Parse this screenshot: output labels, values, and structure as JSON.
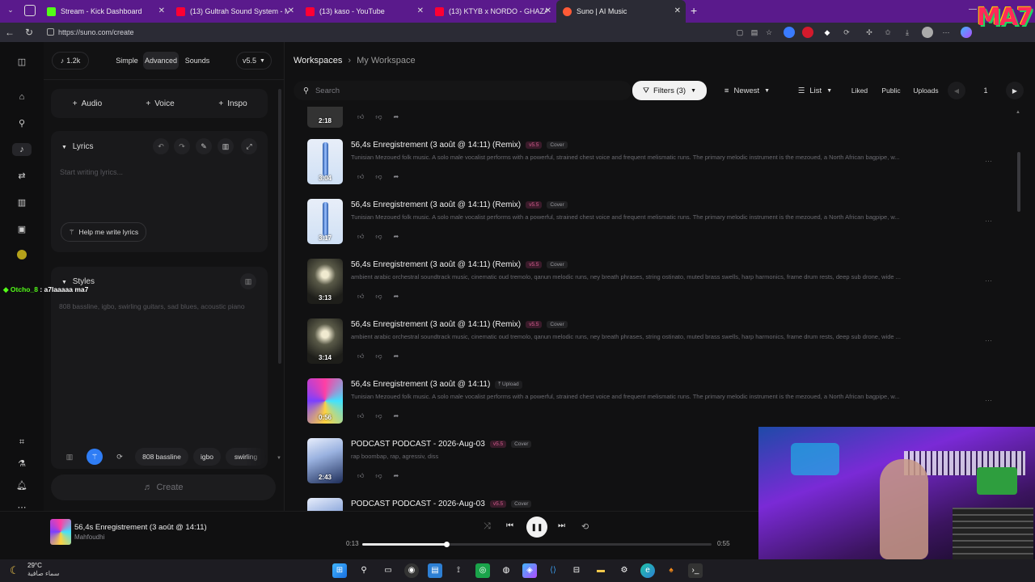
{
  "browser": {
    "tabs": [
      {
        "title": "Stream - Kick Dashboard",
        "color": "#53fc18"
      },
      {
        "title": "(13) Gultrah Sound System - Maze",
        "color": "#ff0033"
      },
      {
        "title": "(13) kaso - YouTube",
        "color": "#ff0033"
      },
      {
        "title": "(13) KTYB x NORDO - GHAZALI (P",
        "color": "#ff0033"
      },
      {
        "title": "Suno | AI Music",
        "color": "#ff5a36"
      }
    ],
    "url": "https://suno.com/create"
  },
  "overlay": {
    "logo_text": "MA7",
    "chat_user": "Otcho_8",
    "chat_message": ": a7laaaaa ma7"
  },
  "create_panel": {
    "credits": "1.2k",
    "modes": [
      "Simple",
      "Advanced",
      "Sounds"
    ],
    "active_mode": "Advanced",
    "model": "v5.5",
    "add_buttons": [
      "Audio",
      "Voice",
      "Inspo"
    ],
    "lyrics": {
      "label": "Lyrics",
      "placeholder": "Start writing lyrics...",
      "help_button": "Help me write lyrics"
    },
    "styles": {
      "label": "Styles",
      "placeholder": "808 bassline, igbo, swirling guitars, sad blues, acoustic piano",
      "tags": [
        "808 bassline",
        "igbo",
        "swirling"
      ]
    },
    "create_label": "Create"
  },
  "workspace": {
    "breadcrumb_root": "Workspaces",
    "breadcrumb_current": "My Workspace",
    "search_placeholder": "Search",
    "filters_label": "Filters (3)",
    "sort_label": "Newest",
    "view_label": "List",
    "chips": [
      "Liked",
      "Public",
      "Uploads"
    ],
    "page": "1",
    "top_partial_duration": "2:18"
  },
  "songs": [
    {
      "title": "56,4s Enregistrement (3 août @ 14:11) (Remix)",
      "version": "v5.5",
      "type": "Cover",
      "duration": "3:04",
      "desc": "Tunisian Mezoued folk music. A solo male vocalist performs with a powerful, strained chest voice and frequent melismatic runs. The primary melodic instrument is the mezoued, a North African bagpipe, w...",
      "thumb": "bagpipe"
    },
    {
      "title": "56,4s Enregistrement (3 août @ 14:11) (Remix)",
      "version": "v5.5",
      "type": "Cover",
      "duration": "3:17",
      "desc": "Tunisian Mezoued folk music. A solo male vocalist performs with a powerful, strained chest voice and frequent melismatic runs. The primary melodic instrument is the mezoued, a North African bagpipe, w...",
      "thumb": "bagpipe"
    },
    {
      "title": "56,4s Enregistrement (3 août @ 14:11) (Remix)",
      "version": "v5.5",
      "type": "Cover",
      "duration": "3:13",
      "desc": "ambient arabic orchestral soundtrack music, cinematic oud tremolo, qanun melodic runs, ney breath phrases, string ostinato, muted brass swells, harp harmonics, frame drum rests, deep sub drone, wide ...",
      "thumb": "arch"
    },
    {
      "title": "56,4s Enregistrement (3 août @ 14:11) (Remix)",
      "version": "v5.5",
      "type": "Cover",
      "duration": "3:14",
      "desc": "ambient arabic orchestral soundtrack music, cinematic oud tremolo, qanun melodic runs, ney breath phrases, string ostinato, muted brass swells, harp harmonics, frame drum rests, deep sub drone, wide ...",
      "thumb": "arch"
    },
    {
      "title": "56,4s Enregistrement (3 août @ 14:11)",
      "version": "",
      "type": "Upload",
      "duration": "0:56",
      "desc": "Tunisian Mezoued folk music. A solo male vocalist performs with a powerful, strained chest voice and frequent melismatic runs. The primary melodic instrument is the mezoued, a North African bagpipe, w...",
      "thumb": "psy"
    },
    {
      "title": "PODCAST PODCAST - 2026-Aug-03",
      "version": "v5.5",
      "type": "Cover",
      "duration": "2:43",
      "desc": "rap boombap, rap, agressiv, diss",
      "thumb": "crystal"
    },
    {
      "title": "PODCAST PODCAST - 2026-Aug-03",
      "version": "v5.5",
      "type": "Cover",
      "duration": "",
      "desc": "",
      "thumb": "crystal"
    }
  ],
  "player": {
    "title": "56,4s Enregistrement (3 août @ 14:11)",
    "artist": "Mahfoudhi",
    "elapsed": "0:13",
    "total": "0:55",
    "progress": 0.24
  },
  "taskbar": {
    "temperature": "29°C",
    "weather": "سماء صافية"
  }
}
